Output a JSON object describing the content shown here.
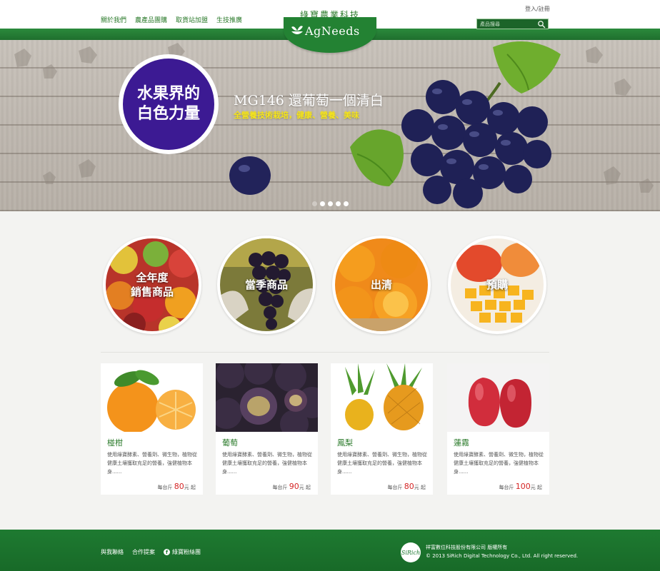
{
  "nav": {
    "items": [
      {
        "label": "關於我們"
      },
      {
        "label": "農產品團購"
      },
      {
        "label": "取貨站加盟"
      },
      {
        "label": "生技推廣"
      }
    ]
  },
  "brand": {
    "name_cn": "綠寶農業科技",
    "logo_text": "AgNeeds"
  },
  "header": {
    "login_label": "登入/註冊",
    "search_placeholder": "產品搜尋"
  },
  "banner": {
    "badge_line1": "水果界的",
    "badge_line2": "白色力量",
    "title": "MG146 還葡萄一個清白",
    "subtitle": "全營養技術栽培，健康、營養、美味",
    "slide_count": 5,
    "active_slide": 1
  },
  "categories": [
    {
      "label": "全年度\n銷售商品",
      "line1": "全年度",
      "line2": "銷售商品"
    },
    {
      "label": "當季商品",
      "line1": "當季商品",
      "line2": ""
    },
    {
      "label": "出清",
      "line1": "出清",
      "line2": ""
    },
    {
      "label": "預購",
      "line1": "預購",
      "line2": ""
    }
  ],
  "products": [
    {
      "name": "椪柑",
      "desc": "使用綠寶酵素、營養劑、微生物，植物從健康土壤獲取充足的營養，強健植物本身......",
      "price_prefix": "每台斤",
      "price": "80",
      "price_suffix": "元 起"
    },
    {
      "name": "葡萄",
      "desc": "使用綠寶酵素、營養劑、微生物，植物從健康土壤獲取充足的營養，強健植物本身......",
      "price_prefix": "每台斤",
      "price": "90",
      "price_suffix": "元 起"
    },
    {
      "name": "鳳梨",
      "desc": "使用綠寶酵素、營養劑、微生物，植物從健康土壤獲取充足的營養，強健植物本身......",
      "price_prefix": "每台斤",
      "price": "80",
      "price_suffix": "元 起"
    },
    {
      "name": "蓮霧",
      "desc": "使用綠寶酵素、營養劑、微生物，植物從健康土壤獲取充足的營養，強健植物本身......",
      "price_prefix": "每台斤",
      "price": "100",
      "price_suffix": "元 起"
    }
  ],
  "footer": {
    "links": [
      {
        "label": "與我聯絡",
        "icon": ""
      },
      {
        "label": "合作提案",
        "icon": ""
      },
      {
        "label": "綠寶粉絲團",
        "icon": "facebook-icon"
      }
    ],
    "logo_text": "SiRich",
    "company": "祥富數位科技股份有限公司 版權所有",
    "copyright": "© 2013 SiRich Digital Technology Co., Ltd. All right reserved."
  },
  "colors": {
    "brand_green": "#238233",
    "badge_purple": "#3c1a93",
    "subtitle_yellow": "#f5e41a",
    "price_red": "#d42424"
  }
}
